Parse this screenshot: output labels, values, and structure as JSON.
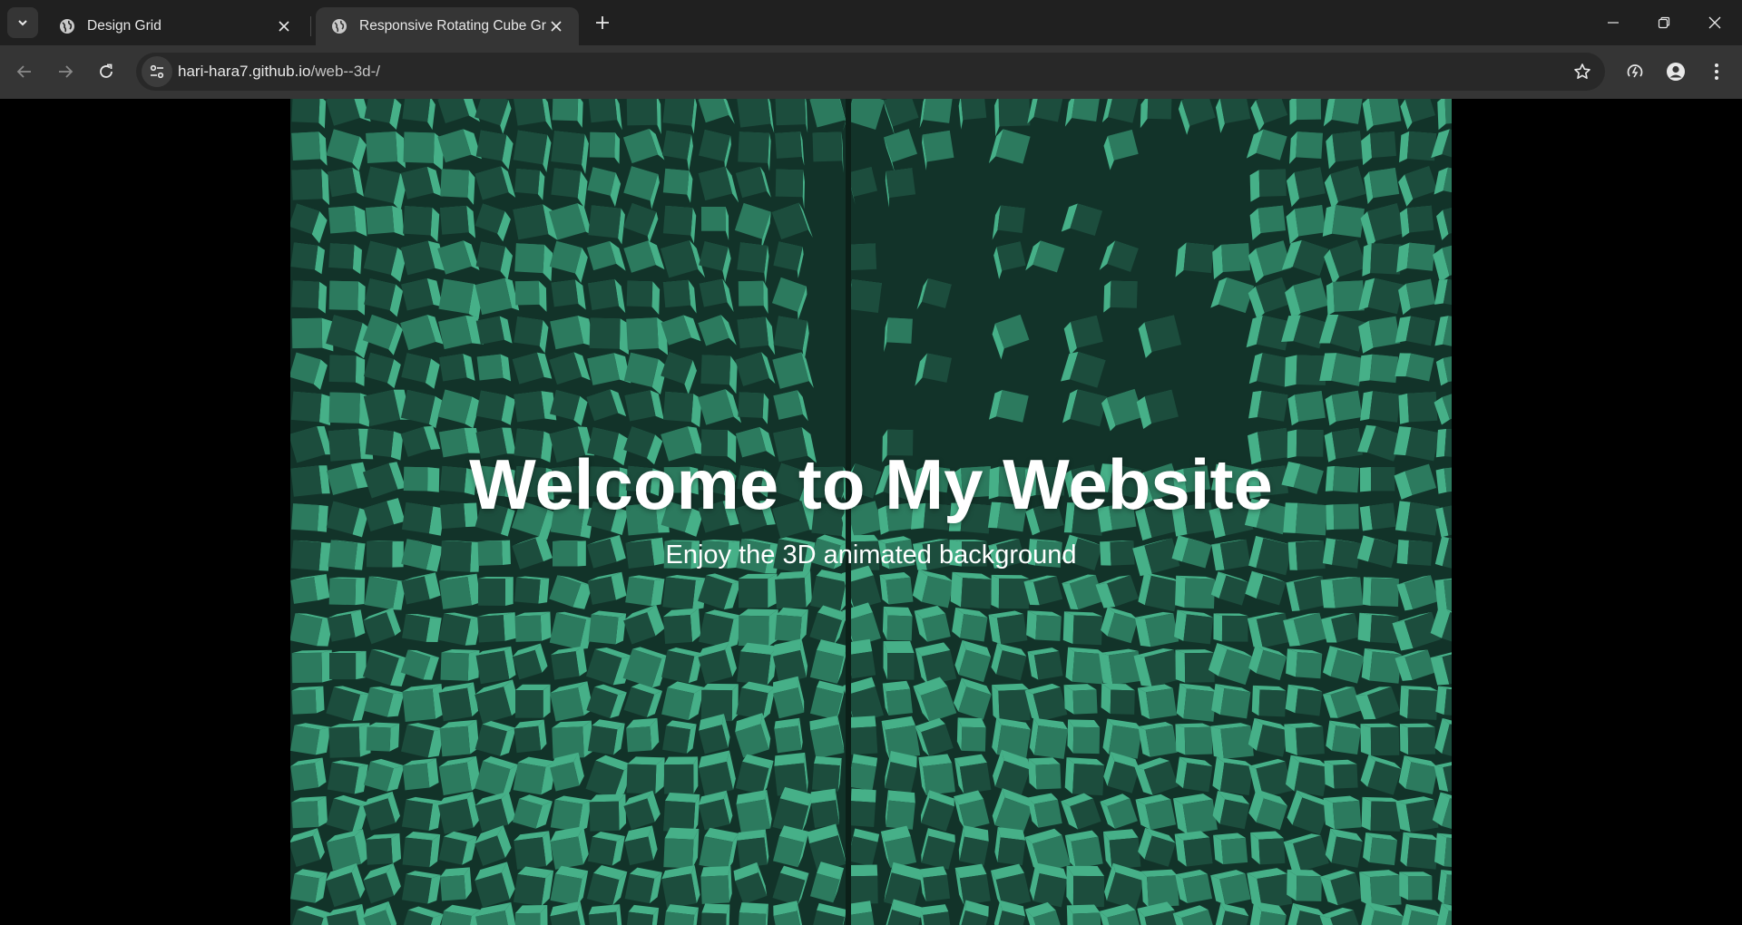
{
  "browser": {
    "tabs": [
      {
        "title": "Design Grid",
        "active": false
      },
      {
        "title": "Responsive Rotating Cube Grid",
        "active": true
      }
    ],
    "address": {
      "host": "hari-hara7.github.io",
      "path": "/web--3d-/"
    }
  },
  "page": {
    "heading": "Welcome to My Website",
    "subheading": "Enjoy the 3D animated background"
  },
  "colors": {
    "cube_light": "#46b088",
    "cube_mid": "#2c7a5e",
    "cube_dark": "#1c4d3d",
    "scene_bg": "#123329"
  }
}
